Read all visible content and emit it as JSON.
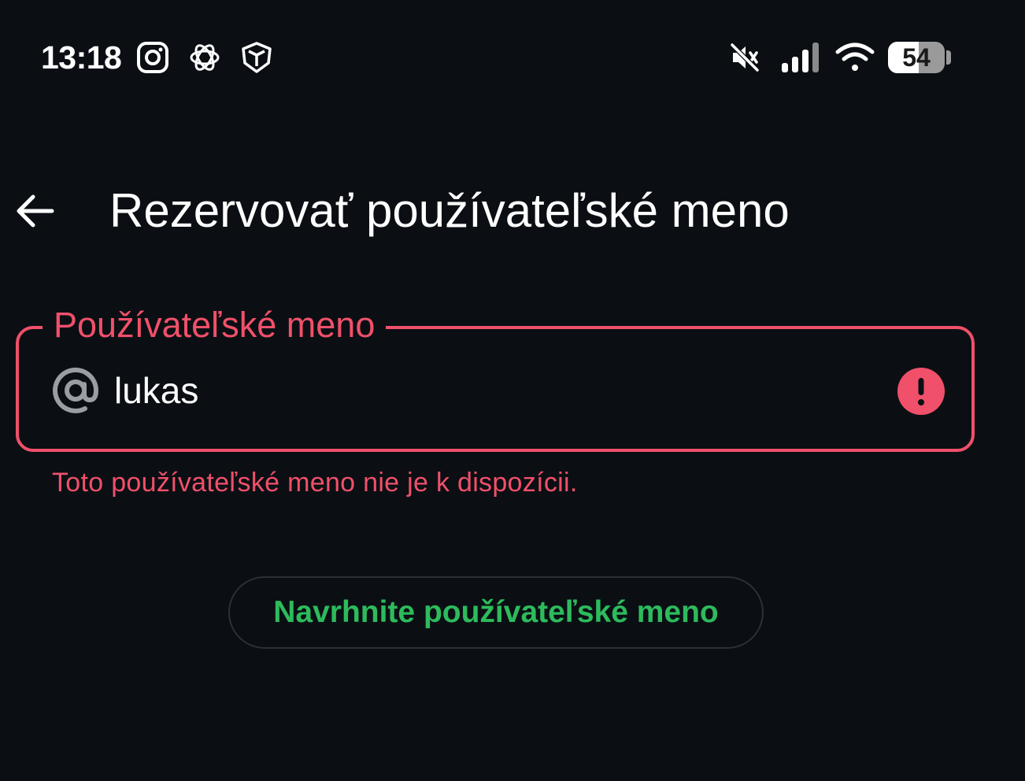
{
  "status_bar": {
    "time": "13:18",
    "battery_level": "54",
    "battery_fraction": 0.54,
    "left_icons": [
      "instagram-icon",
      "chatgpt-icon",
      "shield-app-icon"
    ],
    "right_icons": [
      "mute-icon",
      "cellular-signal-icon",
      "wifi-icon",
      "battery-icon"
    ]
  },
  "app_bar": {
    "back_icon": "arrow-left-icon",
    "title": "Rezervovať používateľské meno"
  },
  "username_field": {
    "label": "Používateľské meno",
    "prefix_icon": "at-icon",
    "value": "lukas",
    "trailing_icon": "error-icon",
    "error_text": "Toto používateľské meno nie je k dispozícii."
  },
  "suggest_button": {
    "label": "Navrhnite používateľské meno"
  },
  "colors": {
    "background": "#0b0f14",
    "error": "#f0506a",
    "accent_green": "#2dbb5c",
    "text": "#ffffff",
    "button_border": "#2b3035"
  }
}
